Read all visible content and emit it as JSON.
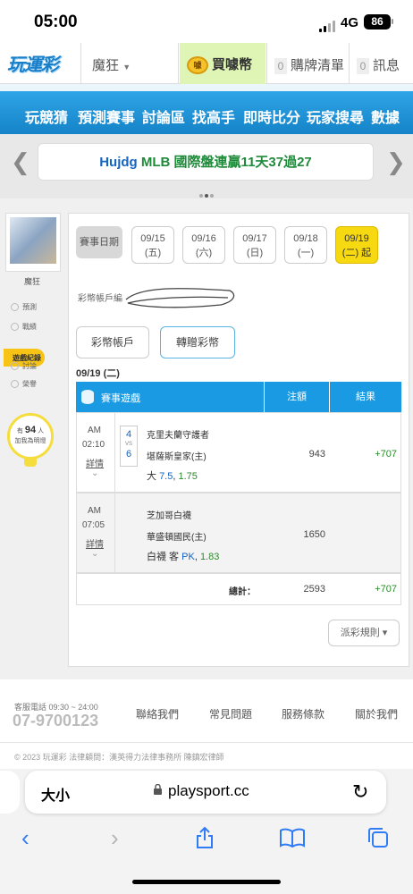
{
  "status": {
    "time": "05:00",
    "network": "4G",
    "battery": "86"
  },
  "topbar": {
    "logo": "玩運彩",
    "user_menu": "魔狂",
    "buy_coins": "買噱幣",
    "coin_icon_text": "噱",
    "cart_count": "0",
    "cart_label": "購牌清單",
    "msg_count": "0",
    "msg_label": "訊息"
  },
  "nav": [
    "玩競猜",
    "預測賽事",
    "討論區",
    "找高手",
    "即時比分",
    "玩家搜尋",
    "數據"
  ],
  "banner": {
    "user": "Hujdg",
    "text": "MLB 國際盤連贏11天37過27"
  },
  "sidebar": {
    "username": "魔狂",
    "links": [
      "預測",
      "戰績",
      "遊戲紀錄",
      "討論",
      "榮譽"
    ],
    "fans_pre": "有",
    "fans_count": "94",
    "fans_unit": "人",
    "fans_post": "加我為明燈"
  },
  "main": {
    "date_label": "賽事日期",
    "dates": [
      {
        "date": "09/15",
        "dow": "(五)"
      },
      {
        "date": "09/16",
        "dow": "(六)"
      },
      {
        "date": "09/17",
        "dow": "(日)"
      },
      {
        "date": "09/18",
        "dow": "(一)"
      },
      {
        "date": "09/19",
        "dow": "(二) 起"
      }
    ],
    "account_label": "彩幣帳戶編",
    "btn_account": "彩幣帳戶",
    "btn_transfer": "轉贈彩幣",
    "selected_date": "09/19 (二)",
    "table": {
      "col_game": "賽事遊戲",
      "col_amount": "注額",
      "col_result": "結果",
      "rows": [
        {
          "ampm": "AM",
          "time": "02:10",
          "detail": "詳情",
          "score_away": "4",
          "score_home": "6",
          "vs": "VS",
          "away": "克里夫蘭守護者",
          "home": "堪薩斯皇家(主)",
          "bet_pick": "大",
          "bet_line": "7.5",
          "bet_odds": "1.75",
          "amount": "943",
          "result": "+707"
        },
        {
          "ampm": "AM",
          "time": "07:05",
          "detail": "詳情",
          "away": "芝加哥白襪",
          "home": "華盛頓國民(主)",
          "bet_pick": "白襪 客",
          "bet_line": "PK",
          "bet_odds": "1.83",
          "amount": "1650",
          "result": ""
        }
      ],
      "total_label": "總計：",
      "total_amount": "2593",
      "total_result": "+707"
    },
    "rule_btn": "派彩規則 ▾"
  },
  "footer": {
    "hotline_label": "客服電話 09:30 ~ 24:00",
    "hotline": "07-9700123",
    "links": [
      "聯絡我們",
      "常見問題",
      "服務條款",
      "關於我們"
    ],
    "copyright": "© 2023 玩運彩  法律顧問：漢英得力法律事務所 陳鎮宏律師"
  },
  "safari": {
    "text_size": "大小",
    "url": "playsport.cc"
  }
}
